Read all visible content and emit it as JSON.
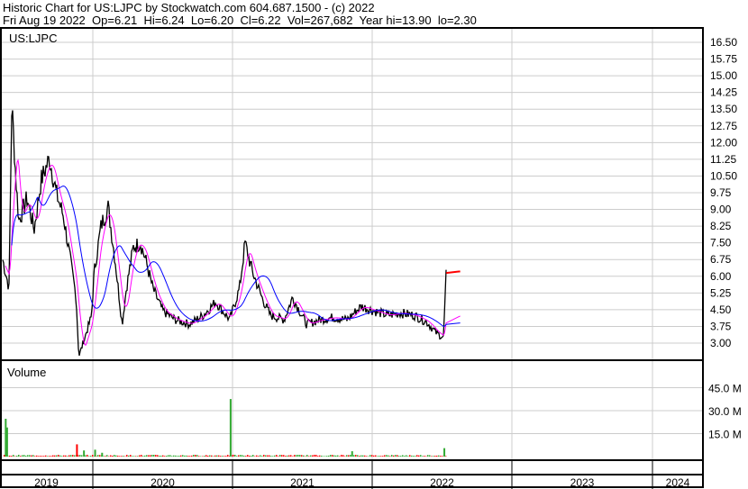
{
  "header": {
    "title": "Historic Chart for US:LJPC by Stockwatch.com 604.687.1500 - (c) 2022",
    "quote": "Fri Aug 19 2022  Op=6.21  Hi=6.24  Lo=6.20  Cl=6.22  Vol=267,682  Year hi=13.90  lo=2.30"
  },
  "chart_data": {
    "type": "line",
    "title": "US:LJPC",
    "volume_label": "Volume",
    "colors": {
      "price": "#000000",
      "ma_short": "#ff00ff",
      "ma_long": "#0000ff",
      "vol_up": "#33aa33",
      "vol_down": "#ff0000",
      "last": "#ff0000"
    },
    "y_ticks": [
      "16.50",
      "15.75",
      "15.00",
      "14.25",
      "13.50",
      "12.75",
      "12.00",
      "11.25",
      "10.50",
      "9.75",
      "9.00",
      "8.25",
      "7.50",
      "6.75",
      "6.00",
      "5.25",
      "4.50",
      "3.75",
      "3.00"
    ],
    "ylim": [
      3.0,
      16.5
    ],
    "vol_ticks": [
      "45.0 M",
      "30.0 M",
      "15.0 M"
    ],
    "vol_tick_values": [
      45,
      30,
      15
    ],
    "x_years": [
      "2019",
      "2020",
      "2021",
      "2022",
      "2023",
      "2024"
    ],
    "price": [
      [
        2019.35,
        6.88
      ],
      [
        2019.4,
        5.47
      ],
      [
        2019.42,
        13.75
      ],
      [
        2019.45,
        10.3
      ],
      [
        2019.47,
        8.5
      ],
      [
        2019.53,
        9.5
      ],
      [
        2019.58,
        8.1
      ],
      [
        2019.63,
        10.3
      ],
      [
        2019.69,
        11.3
      ],
      [
        2019.74,
        9.7
      ],
      [
        2019.79,
        8.7
      ],
      [
        2019.84,
        6.7
      ],
      [
        2019.88,
        5.1
      ],
      [
        2019.9,
        2.4
      ],
      [
        2019.95,
        3.4
      ],
      [
        2019.99,
        4.2
      ],
      [
        2020.01,
        6.2
      ],
      [
        2020.06,
        8.3
      ],
      [
        2020.11,
        9.1
      ],
      [
        2020.16,
        6.7
      ],
      [
        2020.21,
        3.85
      ],
      [
        2020.24,
        5.45
      ],
      [
        2020.29,
        7.3
      ],
      [
        2020.34,
        7.5
      ],
      [
        2020.38,
        6.7
      ],
      [
        2020.43,
        5.45
      ],
      [
        2020.5,
        4.45
      ],
      [
        2020.59,
        4.05
      ],
      [
        2020.69,
        3.85
      ],
      [
        2020.79,
        4.25
      ],
      [
        2020.88,
        4.85
      ],
      [
        2020.98,
        4.05
      ],
      [
        2021.05,
        5.45
      ],
      [
        2021.09,
        7.5
      ],
      [
        2021.14,
        6.25
      ],
      [
        2021.21,
        5.05
      ],
      [
        2021.27,
        4.25
      ],
      [
        2021.37,
        4.05
      ],
      [
        2021.43,
        5.05
      ],
      [
        2021.53,
        3.85
      ],
      [
        2021.63,
        4.05
      ],
      [
        2021.72,
        4.15
      ],
      [
        2021.82,
        4.05
      ],
      [
        2021.92,
        4.65
      ],
      [
        2022.01,
        4.45
      ],
      [
        2022.11,
        4.25
      ],
      [
        2022.2,
        4.35
      ],
      [
        2022.3,
        4.25
      ],
      [
        2022.39,
        3.95
      ],
      [
        2022.46,
        3.45
      ],
      [
        2022.51,
        3.25
      ],
      [
        2022.53,
        6.15
      ],
      [
        2022.63,
        6.22
      ]
    ],
    "volume_spikes_m": [
      [
        2019.37,
        24.7,
        "up"
      ],
      [
        2019.38,
        19,
        "up"
      ],
      [
        2019.88,
        8,
        "down"
      ],
      [
        2019.93,
        4,
        "up"
      ],
      [
        2020.01,
        4.5,
        "up"
      ],
      [
        2020.06,
        2.5,
        "up"
      ],
      [
        2020.98,
        37.6,
        "up"
      ],
      [
        2021.85,
        3.5,
        "up"
      ],
      [
        2022.51,
        5.5,
        "up"
      ]
    ]
  }
}
